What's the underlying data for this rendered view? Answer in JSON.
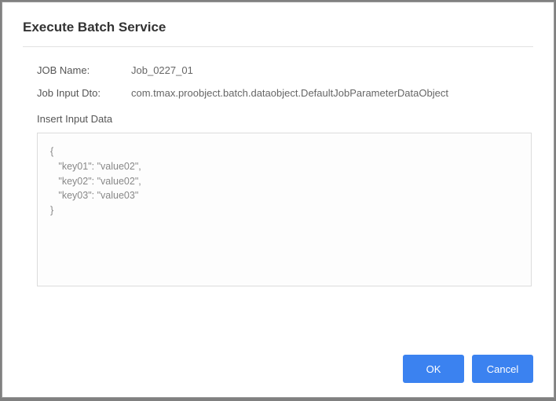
{
  "dialog": {
    "title": "Execute Batch Service",
    "fields": {
      "job_name_label": "JOB Name:",
      "job_name_value": "Job_0227_01",
      "job_input_dto_label": "Job Input Dto:",
      "job_input_dto_value": "com.tmax.proobject.batch.dataobject.DefaultJobParameterDataObject",
      "insert_input_data_label": "Insert Input Data"
    },
    "input_data": "{\n   \"key01\": \"value02\",\n   \"key02\": \"value02\",\n   \"key03\": \"value03\"\n}"
  },
  "buttons": {
    "ok": "OK",
    "cancel": "Cancel"
  }
}
